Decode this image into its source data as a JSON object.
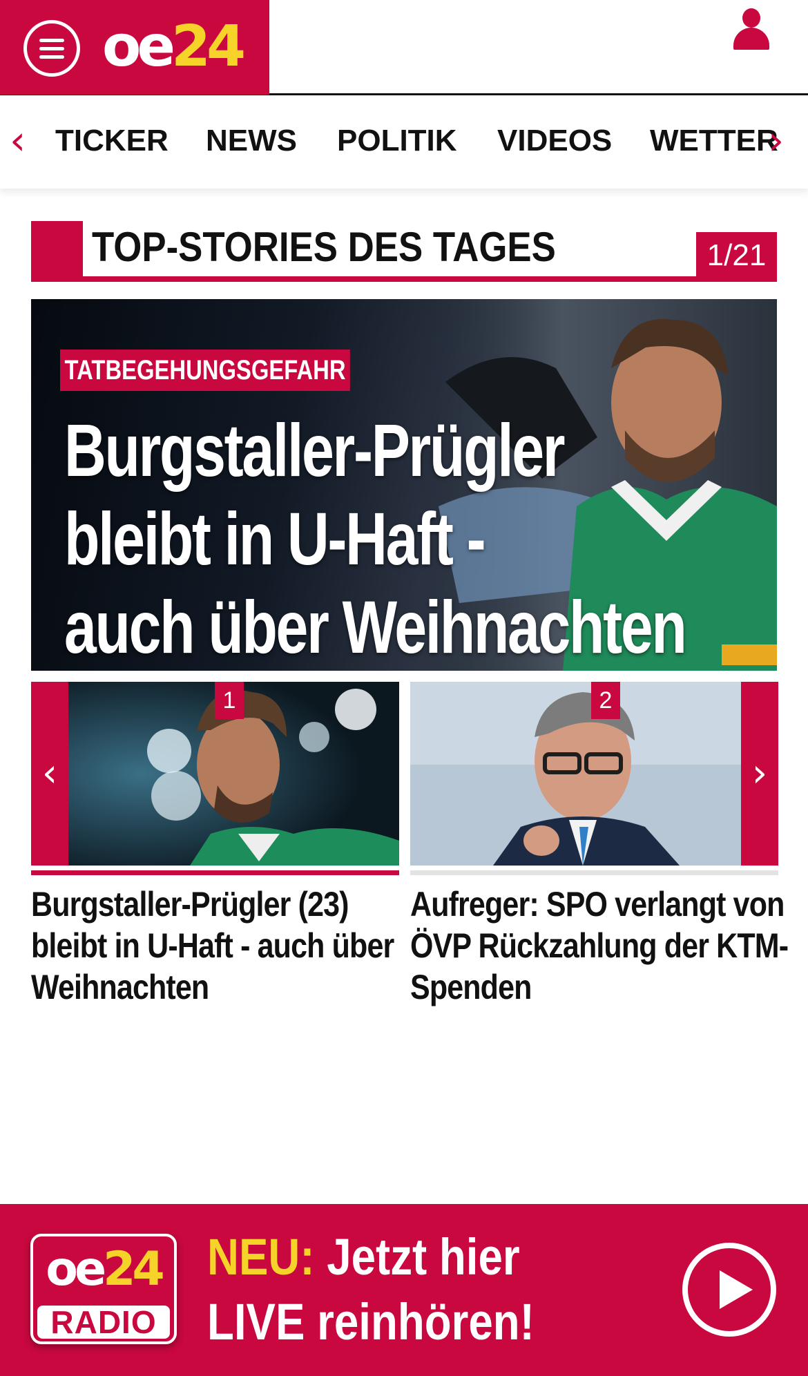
{
  "header": {
    "logo": {
      "oe": "oe",
      "num": "24"
    },
    "menu_icon": "hamburger-menu-icon",
    "user_icon": "user-profile-icon"
  },
  "nav": {
    "left_arrow": "‹",
    "right_arrow": "›",
    "items": [
      "TICKER",
      "NEWS",
      "POLITIK",
      "VIDEOS",
      "WETTER"
    ]
  },
  "section": {
    "title": "TOP-STORIES DES TAGES",
    "counter": "1/21"
  },
  "hero": {
    "kicker": "TATBEGEHUNGSGEFAHR",
    "headline_lines": [
      "Burgstaller-Prügler",
      "bleibt in U-Haft -",
      "auch über Weihnachten"
    ]
  },
  "teasers": [
    {
      "number": "1",
      "caption_lines": [
        "Burgstaller-Prügler (23)",
        "bleibt in U-Haft - auch über",
        "Weihnachten"
      ],
      "active": true
    },
    {
      "number": "2",
      "caption_lines": [
        "Aufreger: SPO verlangt von",
        "ÖVP Rückzahlung der KTM-",
        "Spenden"
      ],
      "active": false
    }
  ],
  "slider": {
    "prev": "‹",
    "next": "›"
  },
  "radio": {
    "logo": {
      "oe": "oe",
      "num": "24",
      "label": "RADIO"
    },
    "neu": "NEU:",
    "line1": "Jetzt hier",
    "line2": "LIVE reinhören!",
    "play_icon": "play-icon"
  },
  "colors": {
    "brand_red": "#c8083e",
    "logo_yellow": "#f5d328",
    "text": "#111111"
  }
}
